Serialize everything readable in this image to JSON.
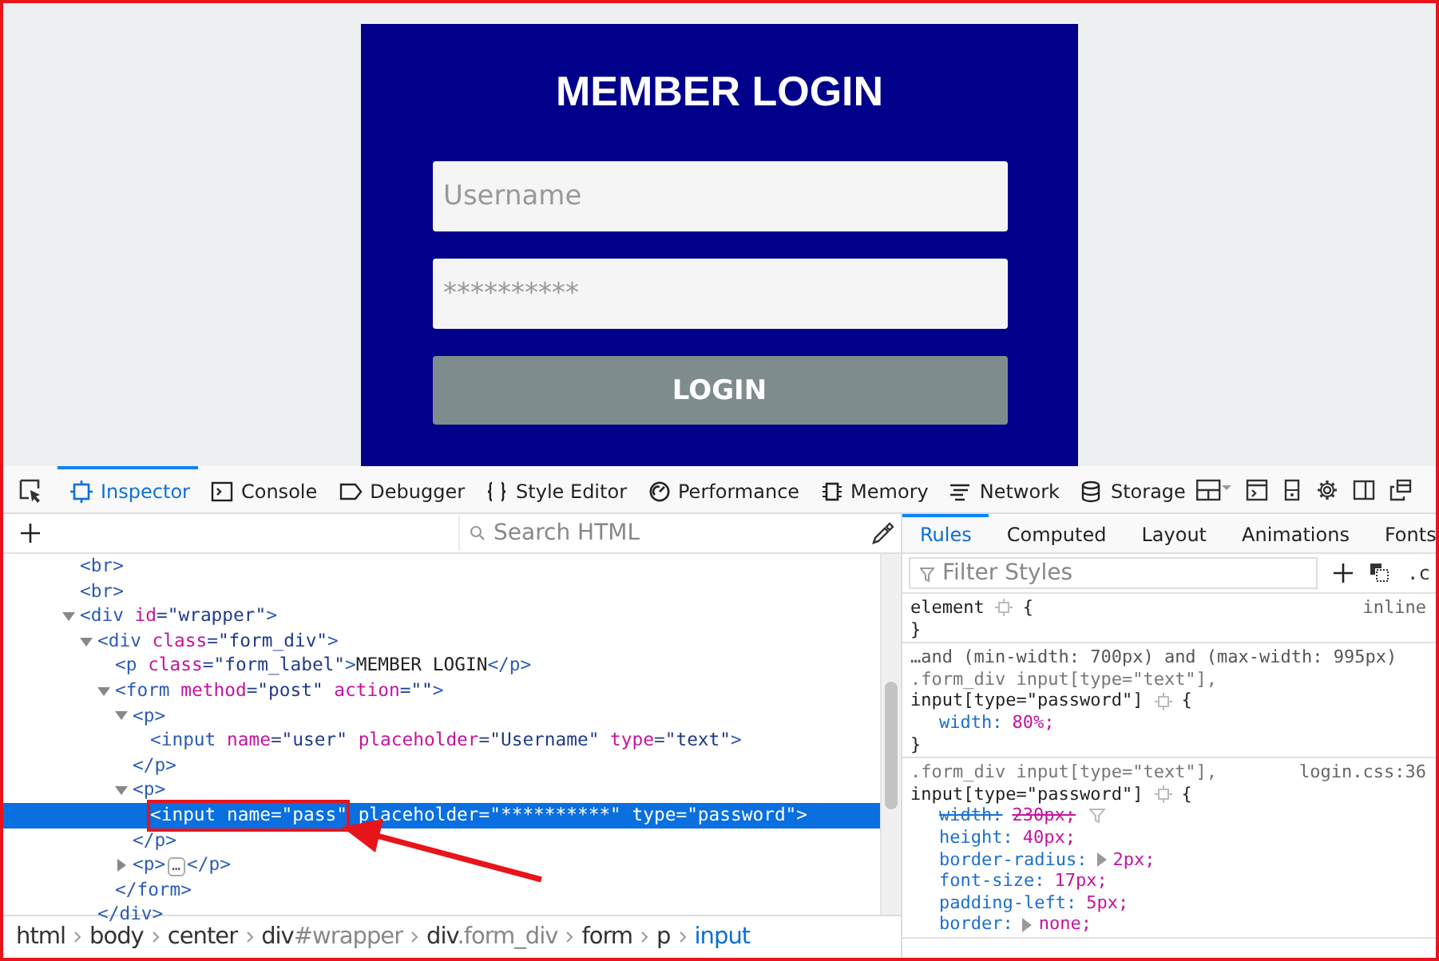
{
  "page": {
    "title": "MEMBER LOGIN",
    "fields": [
      {
        "placeholder": "Username"
      },
      {
        "placeholder": "**********"
      }
    ],
    "button": "LOGIN"
  },
  "toolbar": {
    "tabs": [
      {
        "label": "Inspector",
        "selected": true
      },
      {
        "label": "Console",
        "selected": false
      },
      {
        "label": "Debugger",
        "selected": false
      },
      {
        "label": "Style Editor",
        "selected": false
      },
      {
        "label": "Performance",
        "selected": false
      },
      {
        "label": "Memory",
        "selected": false
      },
      {
        "label": "Network",
        "selected": false
      },
      {
        "label": "Storage",
        "selected": false
      }
    ]
  },
  "inspector": {
    "search": {
      "placeholder": "Search HTML"
    },
    "tree": [
      {
        "selected": false,
        "open": [
          {
            "kind": "tag",
            "text": "<br>"
          }
        ]
      },
      {
        "selected": false,
        "open": [
          {
            "kind": "tag",
            "text": "<br>"
          }
        ]
      },
      {
        "selected": false,
        "expanded": true,
        "open": [
          {
            "kind": "tag",
            "text": "<div"
          },
          {
            "kind": "attr",
            "text": " id"
          },
          {
            "kind": "value",
            "text": "=\"wrapper\""
          },
          {
            "kind": "tag",
            "text": ">"
          }
        ],
        "children": [
          {
            "selected": false,
            "expanded": true,
            "open": [
              {
                "kind": "tag",
                "text": "<div"
              },
              {
                "kind": "attr",
                "text": " class"
              },
              {
                "kind": "value",
                "text": "=\"form_div\""
              },
              {
                "kind": "tag",
                "text": ">"
              }
            ],
            "close": [
              {
                "kind": "tag",
                "text": "</div>"
              }
            ],
            "children": [
              {
                "selected": false,
                "open": [
                  {
                    "kind": "tag",
                    "text": "<p"
                  },
                  {
                    "kind": "attr",
                    "text": " class"
                  },
                  {
                    "kind": "value",
                    "text": "=\"form_label\""
                  },
                  {
                    "kind": "tag",
                    "text": ">"
                  },
                  {
                    "kind": "text",
                    "text": "MEMBER LOGIN"
                  },
                  {
                    "kind": "tag",
                    "text": "</p>"
                  }
                ]
              },
              {
                "selected": false,
                "expanded": true,
                "open": [
                  {
                    "kind": "tag",
                    "text": "<form"
                  },
                  {
                    "kind": "attr",
                    "text": " method"
                  },
                  {
                    "kind": "value",
                    "text": "=\"post\""
                  },
                  {
                    "kind": "attr",
                    "text": " action"
                  },
                  {
                    "kind": "value",
                    "text": "=\"\""
                  },
                  {
                    "kind": "tag",
                    "text": ">"
                  }
                ],
                "close": [
                  {
                    "kind": "tag",
                    "text": "</form>"
                  }
                ],
                "children": [
                  {
                    "selected": false,
                    "expanded": true,
                    "open": [
                      {
                        "kind": "tag",
                        "text": "<p>"
                      }
                    ],
                    "close": [
                      {
                        "kind": "tag",
                        "text": "</p>"
                      }
                    ],
                    "children": [
                      {
                        "selected": false,
                        "open": [
                          {
                            "kind": "tag",
                            "text": "<input"
                          },
                          {
                            "kind": "attr",
                            "text": " name"
                          },
                          {
                            "kind": "value",
                            "text": "=\"user\""
                          },
                          {
                            "kind": "attr",
                            "text": " placeholder"
                          },
                          {
                            "kind": "value",
                            "text": "=\"Username\""
                          },
                          {
                            "kind": "attr",
                            "text": " type"
                          },
                          {
                            "kind": "value",
                            "text": "=\"text\""
                          },
                          {
                            "kind": "tag",
                            "text": ">"
                          }
                        ]
                      }
                    ]
                  },
                  {
                    "selected": false,
                    "expanded": true,
                    "open": [
                      {
                        "kind": "tag",
                        "text": "<p>"
                      }
                    ],
                    "close": [
                      {
                        "kind": "tag",
                        "text": "</p>"
                      }
                    ],
                    "children": [
                      {
                        "selected": true,
                        "open": [
                          {
                            "kind": "tag",
                            "text": "<input",
                            "boxed": true
                          },
                          {
                            "kind": "attr",
                            "text": " name",
                            "boxed": true
                          },
                          {
                            "kind": "value",
                            "text": "=\"pass\"",
                            "boxed": true
                          },
                          {
                            "kind": "attr",
                            "text": " placeholder",
                            "boxed": false
                          },
                          {
                            "kind": "value",
                            "text": "=\"**********\"",
                            "boxed": false
                          },
                          {
                            "kind": "attr",
                            "text": " type",
                            "boxed": false
                          },
                          {
                            "kind": "value",
                            "text": "=\"password\"",
                            "boxed": false
                          },
                          {
                            "kind": "tag",
                            "text": ">",
                            "boxed": false
                          }
                        ]
                      }
                    ]
                  },
                  {
                    "selected": false,
                    "expanded": false,
                    "open": [
                      {
                        "kind": "tag",
                        "text": "<p>"
                      },
                      {
                        "kind": "badge",
                        "text": "…"
                      },
                      {
                        "kind": "tag",
                        "text": "</p>"
                      }
                    ]
                  }
                ]
              }
            ]
          }
        ]
      }
    ],
    "breadcrumbs": [
      {
        "name": "html",
        "selected": false
      },
      {
        "name": "body",
        "selected": false
      },
      {
        "name": "center",
        "selected": false
      },
      {
        "name": "div",
        "suffix": "#wrapper",
        "selected": false
      },
      {
        "name": "div",
        "suffix": ".form_div",
        "selected": false
      },
      {
        "name": "form",
        "selected": false
      },
      {
        "name": "p",
        "selected": false
      },
      {
        "name": "input",
        "selected": true
      }
    ]
  },
  "rules_panel": {
    "tabs": [
      {
        "label": "Rules",
        "selected": true
      },
      {
        "label": "Computed",
        "selected": false
      },
      {
        "label": "Layout",
        "selected": false
      },
      {
        "label": "Animations",
        "selected": false
      },
      {
        "label": "Fonts",
        "selected": false
      }
    ],
    "filter": {
      "placeholder": "Filter Styles"
    },
    "class_toggle": ".c",
    "rules": [
      {
        "selectors": [
          "element"
        ],
        "open": "{",
        "source": "inline",
        "close": "}"
      },
      {
        "media": "…and (min-width: 700px) and (max-width: 995px)",
        "selectors": [
          ".form_div input[type=\"text\"],",
          "input[type=\"password\"]"
        ],
        "open": "{",
        "declarations": [
          {
            "property": "width:",
            "value": "80%;",
            "overridden": false,
            "expandable": false
          }
        ],
        "close": "}"
      },
      {
        "selectors": [
          ".form_div input[type=\"text\"],",
          "input[type=\"password\"]"
        ],
        "open": "{",
        "source": "login.css:36",
        "declarations": [
          {
            "property": "width:",
            "value": "230px;",
            "overridden": true,
            "expandable": false
          },
          {
            "property": "height:",
            "value": "40px;",
            "overridden": false,
            "expandable": false
          },
          {
            "property": "border-radius:",
            "value": "2px;",
            "overridden": false,
            "expandable": true
          },
          {
            "property": "font-size:",
            "value": "17px;",
            "overridden": false,
            "expandable": false
          },
          {
            "property": "padding-left:",
            "value": "5px;",
            "overridden": false,
            "expandable": false
          },
          {
            "property": "border:",
            "value": "none;",
            "overridden": false,
            "expandable": true
          }
        ]
      }
    ]
  }
}
